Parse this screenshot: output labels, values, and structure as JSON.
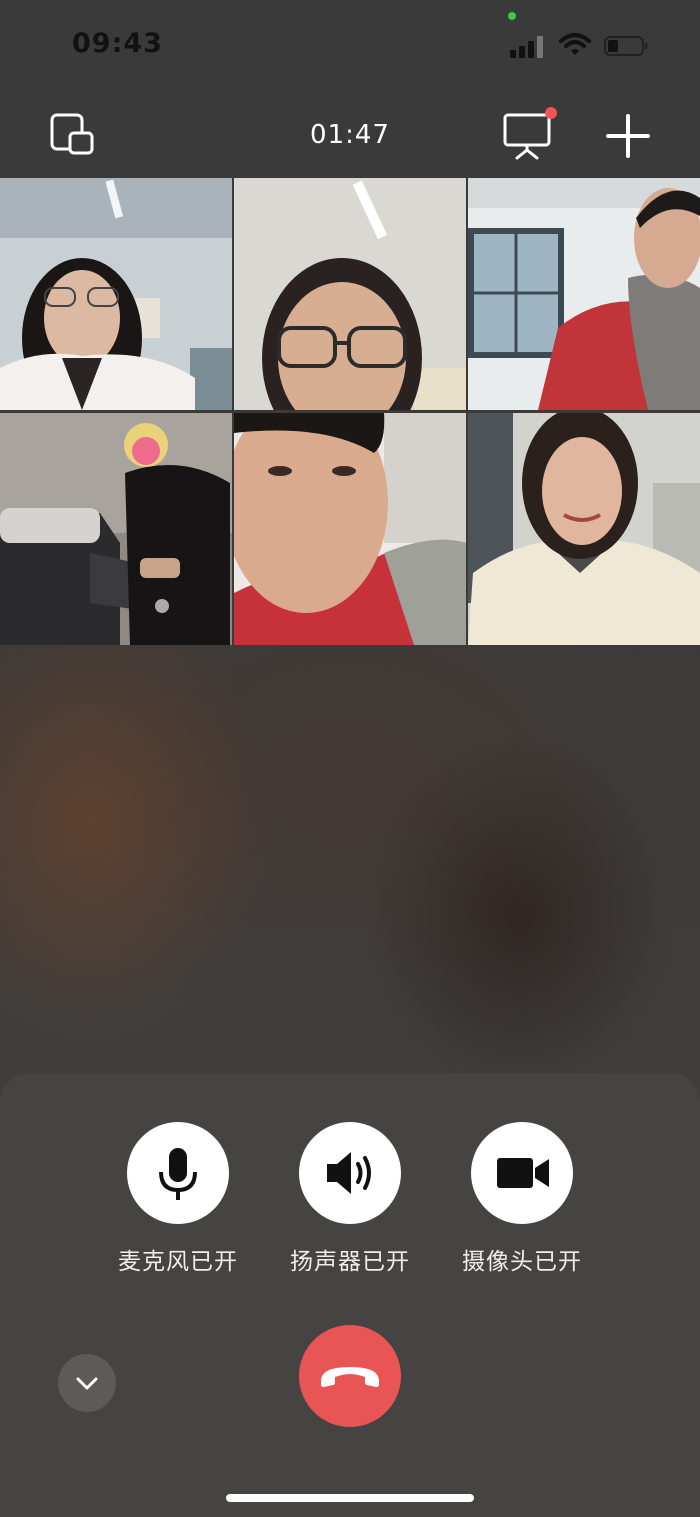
{
  "status_bar": {
    "time": "09:43"
  },
  "topbar": {
    "call_duration": "01:47",
    "icons": [
      "picture-in-picture-icon",
      "screen-share-icon",
      "add-icon"
    ]
  },
  "participants": [
    {
      "position": "top-left",
      "description": "camera-feed"
    },
    {
      "position": "top-center",
      "description": "camera-feed"
    },
    {
      "position": "top-right",
      "description": "camera-feed"
    },
    {
      "position": "bottom-left",
      "description": "camera-feed"
    },
    {
      "position": "bottom-center",
      "description": "camera-feed"
    },
    {
      "position": "bottom-right",
      "description": "camera-feed"
    }
  ],
  "controls": {
    "microphone_label": "麦克风已开",
    "speaker_label": "扬声器已开",
    "camera_label": "摄像头已开"
  },
  "colors": {
    "hangup": "#e95554",
    "notification_dot": "#f2545b",
    "panel": "#464442"
  }
}
